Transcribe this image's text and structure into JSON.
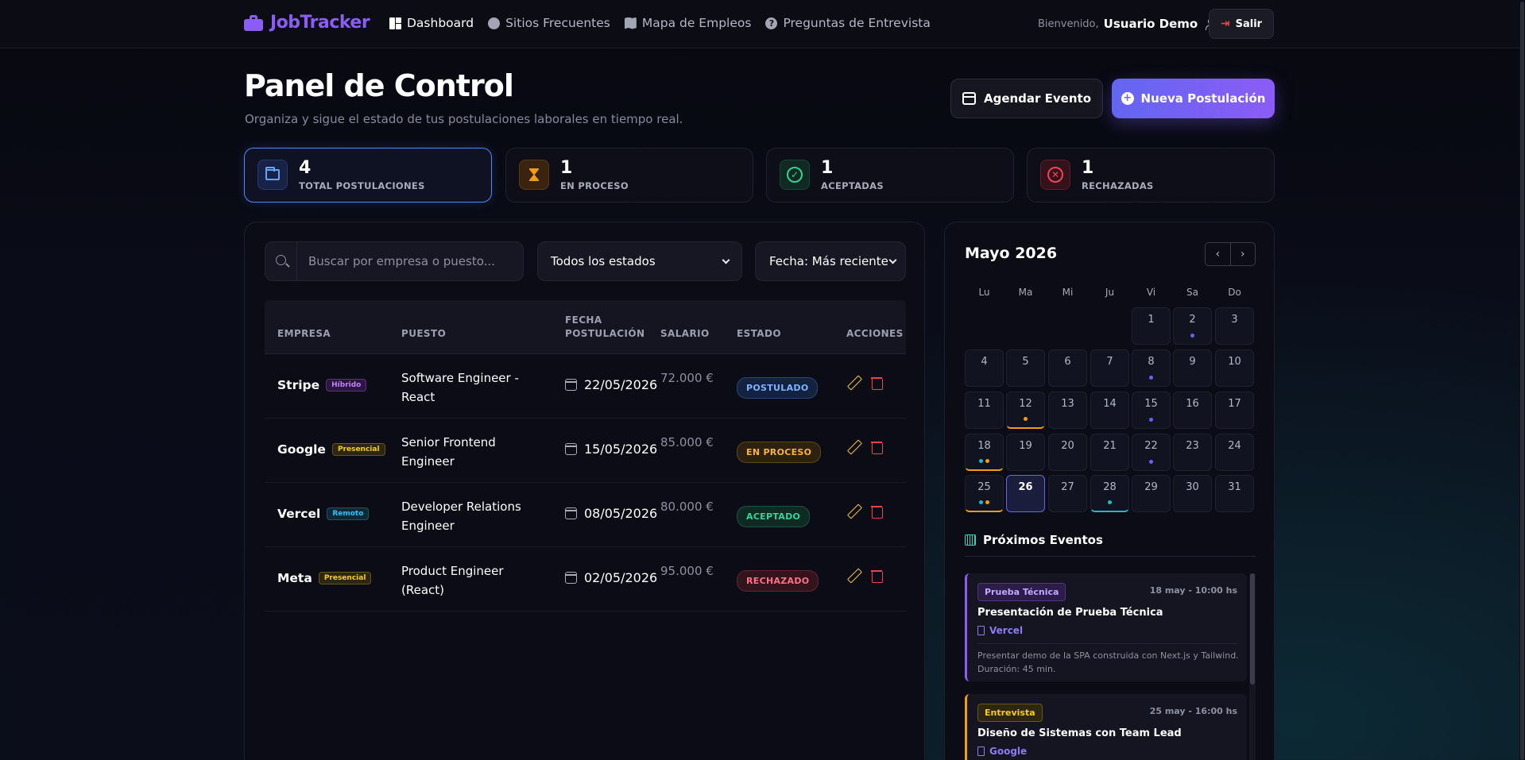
{
  "brand": {
    "name": "JobTracker"
  },
  "nav": [
    {
      "label": "Dashboard"
    },
    {
      "label": "Sitios Frecuentes"
    },
    {
      "label": "Mapa de Empleos"
    },
    {
      "label": "Preguntas de Entrevista"
    }
  ],
  "user": {
    "welcome": "Bienvenido,",
    "name": "Usuario Demo",
    "logout": "Salir"
  },
  "header": {
    "title": "Panel de Control",
    "subtitle": "Organiza y sigue el estado de tus postulaciones laborales en tiempo real.",
    "schedule_btn": "Agendar Evento",
    "new_btn": "Nueva Postulación"
  },
  "stats": [
    {
      "value": "4",
      "label": "TOTAL POSTULACIONES",
      "icon": "folder-icon"
    },
    {
      "value": "1",
      "label": "EN PROCESO",
      "icon": "hourglass-icon"
    },
    {
      "value": "1",
      "label": "ACEPTADAS",
      "icon": "check-circle-icon"
    },
    {
      "value": "1",
      "label": "RECHAZADAS",
      "icon": "x-circle-icon"
    }
  ],
  "filters": {
    "search_placeholder": "Buscar por empresa o puesto...",
    "status": "Todos los estados",
    "date": "Fecha: Más reciente"
  },
  "table": {
    "headers": {
      "empresa": "EMPRESA",
      "puesto": "PUESTO",
      "fecha": "FECHA POSTULACIÓN",
      "salario": "SALARIO",
      "estado": "ESTADO",
      "acciones": "ACCIONES"
    },
    "rows": [
      {
        "company": "Stripe",
        "mode": "Híbrido",
        "position": "Software Engineer - React",
        "date": "22/05/2026",
        "salary": "72.000 €",
        "status": "POSTULADO"
      },
      {
        "company": "Google",
        "mode": "Presencial",
        "position": "Senior Frontend Engineer",
        "date": "15/05/2026",
        "salary": "85.000 €",
        "status": "EN PROCESO"
      },
      {
        "company": "Vercel",
        "mode": "Remoto",
        "position": "Developer Relations Engineer",
        "date": "08/05/2026",
        "salary": "80.000 €",
        "status": "ACEPTADO"
      },
      {
        "company": "Meta",
        "mode": "Presencial",
        "position": "Product Engineer (React)",
        "date": "02/05/2026",
        "salary": "95.000 €",
        "status": "RECHAZADO"
      }
    ]
  },
  "calendar": {
    "month": "Mayo 2026",
    "weekdays": [
      "Lu",
      "Ma",
      "Mi",
      "Ju",
      "Vi",
      "Sa",
      "Do"
    ],
    "today": 26,
    "events_title": "Próximos Eventos",
    "events": [
      {
        "type": "Prueba Técnica",
        "when": "18 may - 10:00 hs",
        "title": "Presentación de Prueba Técnica",
        "company": "Vercel",
        "description": "Presentar demo de la SPA construida con Next.js y Tailwind. Duración: 45 min."
      },
      {
        "type": "Entrevista",
        "when": "25 may - 16:00 hs",
        "title": "Diseño de Sistemas con Team Lead",
        "company": "Google"
      }
    ]
  },
  "colors": {
    "accent": "#8b5cf6",
    "primary": "#6366f1",
    "warning": "#f59e0b",
    "success": "#34d399",
    "danger": "#ef4444",
    "info": "#22b8cf"
  }
}
